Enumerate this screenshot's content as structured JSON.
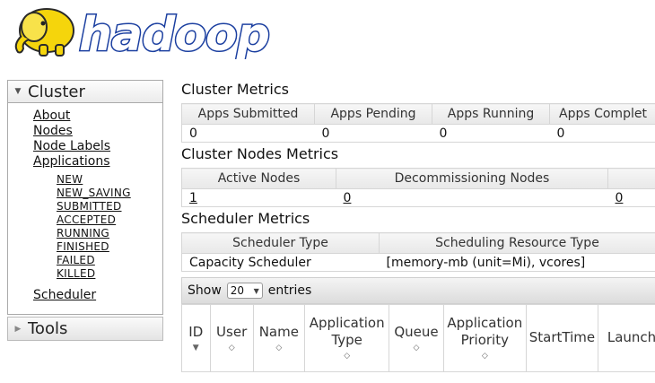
{
  "logo": {
    "text": "hadoop"
  },
  "sidebar": {
    "cluster": {
      "title": "Cluster",
      "links": [
        "About",
        "Nodes",
        "Node Labels",
        "Applications"
      ],
      "states": [
        "NEW",
        "NEW_SAVING",
        "SUBMITTED",
        "ACCEPTED",
        "RUNNING",
        "FINISHED",
        "FAILED",
        "KILLED"
      ],
      "scheduler": "Scheduler"
    },
    "tools": {
      "title": "Tools"
    }
  },
  "cluster_metrics": {
    "title": "Cluster Metrics",
    "headers": [
      "Apps Submitted",
      "Apps Pending",
      "Apps Running",
      "Apps Complet"
    ],
    "values": [
      "0",
      "0",
      "0",
      "0"
    ]
  },
  "nodes_metrics": {
    "title": "Cluster Nodes Metrics",
    "headers": [
      "Active Nodes",
      "Decommissioning Nodes",
      ""
    ],
    "values": [
      "1",
      "0",
      "0"
    ]
  },
  "scheduler_metrics": {
    "title": "Scheduler Metrics",
    "headers": [
      "Scheduler Type",
      "Scheduling Resource Type"
    ],
    "values": [
      "Capacity Scheduler",
      "[memory-mb (unit=Mi), vcores]"
    ]
  },
  "entries": {
    "show_label": "Show",
    "page_size": "20",
    "entries_label": "entries"
  },
  "apps_table": {
    "columns": [
      {
        "line1": "ID",
        "line2": ""
      },
      {
        "line1": "User",
        "line2": ""
      },
      {
        "line1": "Name",
        "line2": ""
      },
      {
        "line1": "Application",
        "line2": "Type"
      },
      {
        "line1": "Queue",
        "line2": ""
      },
      {
        "line1": "Application",
        "line2": "Priority"
      },
      {
        "line1": "StartTime",
        "line2": ""
      },
      {
        "line1": "LaunchT",
        "line2": ""
      }
    ]
  },
  "colors": {
    "logo_blue": "#1b3fa0",
    "elephant_yellow": "#f5d50c"
  }
}
